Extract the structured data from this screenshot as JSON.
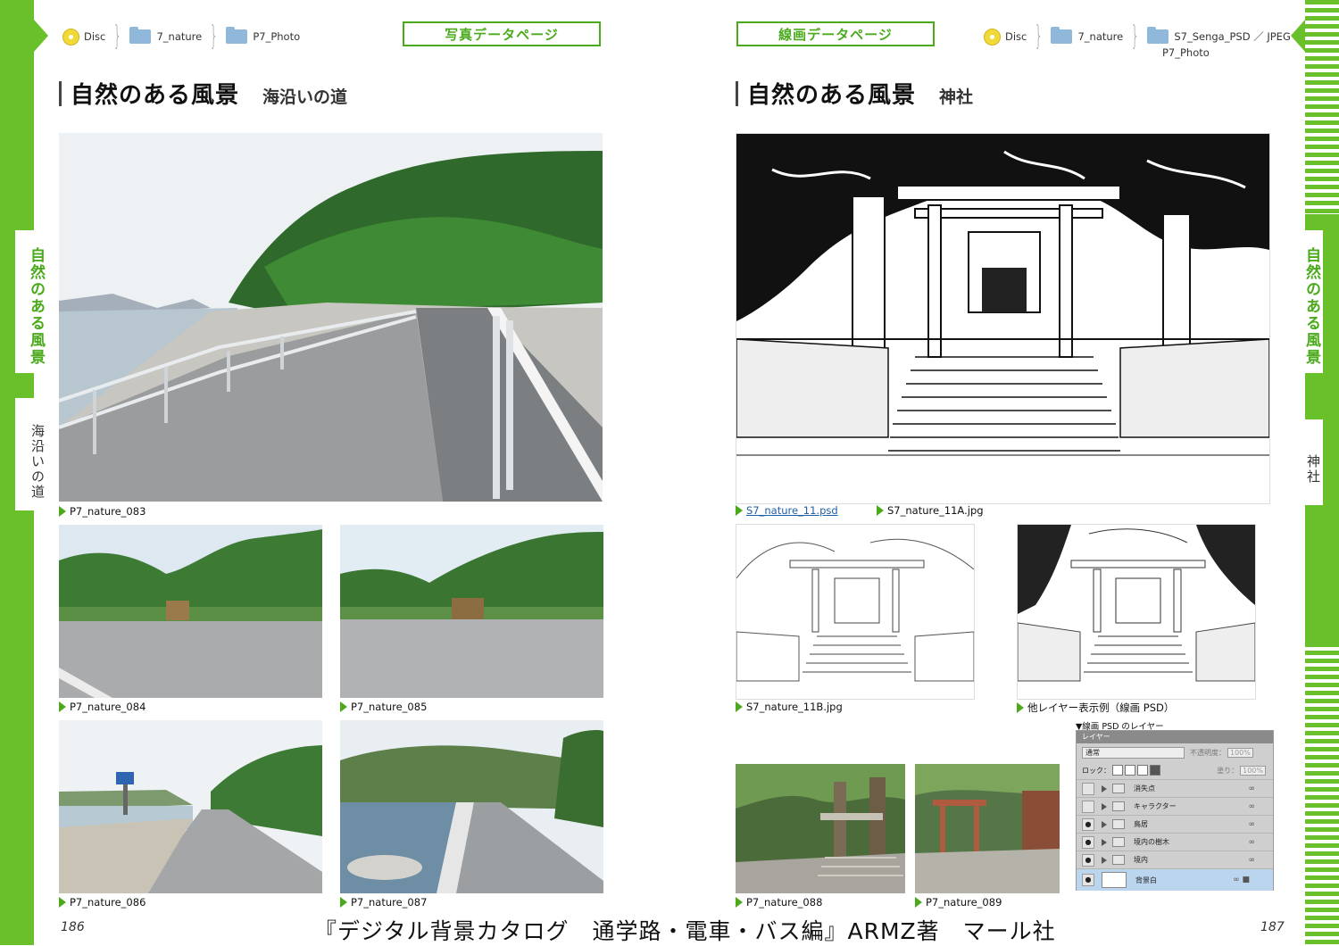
{
  "left_page": {
    "breadcrumb": [
      "Disc",
      "7_nature",
      "P7_Photo"
    ],
    "page_type_label": "写真データページ",
    "title": "自然のある風景",
    "subtitle": "海沿いの道",
    "side_tab_category": "自然のある風景",
    "side_tab_sub": "海沿いの道",
    "page_number": "186",
    "photos": [
      {
        "caption": "P7_nature_083"
      },
      {
        "caption": "P7_nature_084"
      },
      {
        "caption": "P7_nature_085"
      },
      {
        "caption": "P7_nature_086"
      },
      {
        "caption": "P7_nature_087"
      }
    ]
  },
  "right_page": {
    "breadcrumb": [
      "Disc",
      "7_nature",
      "S7_Senga_PSD ／ JPEG",
      "P7_Photo"
    ],
    "page_type_label": "線画データページ",
    "title": "自然のある風景",
    "subtitle": "神社",
    "side_tab_category": "自然のある風景",
    "side_tab_sub": "神社",
    "page_number": "187",
    "captions": {
      "main_psd": "S7_nature_11.psd",
      "main_jpg": "S7_nature_11A.jpg",
      "line_b": "S7_nature_11B.jpg",
      "layer_example": "他レイヤー表示例（線画 PSD）",
      "photo_088": "P7_nature_088",
      "photo_089": "P7_nature_089"
    },
    "layer_panel": {
      "heading": "▼線画 PSD のレイヤー",
      "tab": "レイヤー",
      "blend_mode": "通常",
      "opacity_label": "不透明度：",
      "opacity_value": "100%",
      "lock_label": "ロック：",
      "fill_label": "塗り：",
      "fill_value": "100%",
      "layers": [
        {
          "name": "消失点",
          "visible": false
        },
        {
          "name": "キャラクター",
          "visible": false
        },
        {
          "name": "鳥居",
          "visible": true
        },
        {
          "name": "境内の樹木",
          "visible": true
        },
        {
          "name": "境内",
          "visible": true
        },
        {
          "name": "背景白",
          "visible": true
        }
      ]
    }
  },
  "credit": "『デジタル背景カタログ　通学路・電車・バス編』ARMZ著　マール社",
  "colors": {
    "accent_green": "#69c02a",
    "label_green": "#4aaa1c",
    "link_blue": "#1f5fa8"
  }
}
